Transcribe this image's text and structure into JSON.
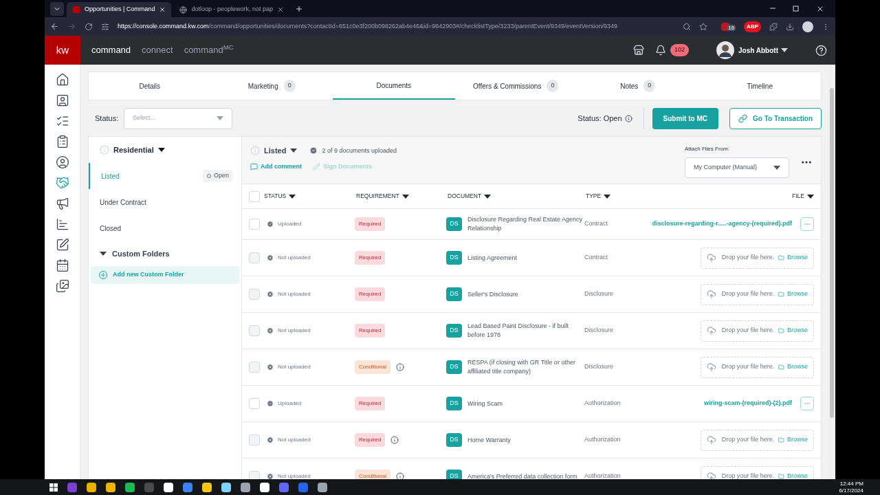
{
  "browser": {
    "tabs": [
      {
        "title": "Opportunities | Command",
        "selected": true
      },
      {
        "title": "dotloop - peoplework, not pap",
        "selected": false
      }
    ],
    "url_host": "https://console.command.kw.com",
    "url_path": "/command/opportunities/documents?contactId=651c0e3f200b098262ab4e46&id=9642903#/checklistType/3233/parentEvent/9349/eventVersion/9349",
    "extension_badge": "16",
    "adblock_label": "ABP"
  },
  "header": {
    "logo": "kw",
    "nav": [
      {
        "label": "command",
        "selected": true
      },
      {
        "label": "connect",
        "selected": false
      },
      {
        "label": "command$^{MC}$",
        "selected": false
      }
    ],
    "notification_count": "102",
    "user": "Josh Abbott"
  },
  "sidebar": [
    {
      "selected": false
    },
    {
      "selected": false
    },
    {
      "selected": false
    },
    {
      "selected": false
    },
    {
      "selected": false
    },
    {
      "selected": true
    },
    {
      "selected": false
    },
    {
      "selected": false
    },
    {
      "selected": false
    },
    {
      "selected": false
    },
    {
      "selected": false
    }
  ],
  "page_tabs": [
    {
      "label": "Details",
      "selected": false
    },
    {
      "label": "Marketing",
      "count": "0",
      "selected": false
    },
    {
      "label": "Documents",
      "selected": true
    },
    {
      "label": "Offers & Commissions",
      "count": "0",
      "selected": false
    },
    {
      "label": "Notes",
      "count": "0",
      "selected": false
    },
    {
      "label": "Timeline",
      "selected": false
    }
  ],
  "toolbar": {
    "status_label": "Status:",
    "status_placeholder": "Select...",
    "status_text": "Status: Open",
    "submit": "Submit to MC",
    "go": "Go To Transaction"
  },
  "stages": {
    "group": "Residential",
    "items": [
      {
        "label": "Listed",
        "badge": "Open",
        "selected": true
      },
      {
        "label": "Under Contract",
        "selected": false
      },
      {
        "label": "Closed",
        "selected": false
      }
    ],
    "custom_folders": "Custom Folders",
    "add_folder": "Add new Custom Folder"
  },
  "documents": {
    "stage": "Listed",
    "progress": "2 of 9 documents uploaded",
    "add_comment": "Add comment",
    "sign": {
      "label": "Sign Documents",
      "disabled": true
    },
    "attach_label": "Attach Files From:",
    "attach_value": "My Computer (Manual)",
    "select_all_checked": false,
    "columns": [
      "STATUS",
      "REQUIREMENT",
      "DOCUMENT",
      "TYPE",
      "FILE"
    ],
    "rows": [
      {
        "uploaded": true,
        "status": "Uploaded",
        "requirement": {
          "text": "Required",
          "kind": "required"
        },
        "info": false,
        "badge": "DS",
        "name": "Disclosure Regarding Real Estate Agency Relationship",
        "type": "Contract",
        "file": {
          "kind": "file",
          "name": "disclosure-regarding-r.....-agency-(required).pdf"
        }
      },
      {
        "uploaded": false,
        "status": "Not uploaded",
        "requirement": {
          "text": "Required",
          "kind": "required"
        },
        "info": false,
        "badge": "DS",
        "name": "Listing Agreement",
        "type": "Contract",
        "file": {
          "kind": "drop",
          "text": "Drop your file here.",
          "browse": "Browse"
        }
      },
      {
        "uploaded": false,
        "status": "Not uploaded",
        "requirement": {
          "text": "Required",
          "kind": "required"
        },
        "info": false,
        "badge": "DS",
        "name": "Seller's Disclosure",
        "type": "Disclosure",
        "file": {
          "kind": "drop",
          "text": "Drop your file here.",
          "browse": "Browse"
        }
      },
      {
        "uploaded": false,
        "status": "Not uploaded",
        "requirement": {
          "text": "Required",
          "kind": "required"
        },
        "info": false,
        "badge": "DS",
        "name": "Lead Based Paint Disclosure - if built before 1978",
        "type": "Disclosure",
        "file": {
          "kind": "drop",
          "text": "Drop your file here.",
          "browse": "Browse"
        }
      },
      {
        "uploaded": false,
        "status": "Not uploaded",
        "requirement": {
          "text": "Conditional",
          "kind": "conditional"
        },
        "info": true,
        "badge": "DS",
        "name": "RESPA (if closing with GR Title or other affiliated title company)",
        "type": "Disclosure",
        "file": {
          "kind": "drop",
          "text": "Drop your file here.",
          "browse": "Browse"
        }
      },
      {
        "uploaded": true,
        "status": "Uploaded",
        "requirement": {
          "text": "Required",
          "kind": "required"
        },
        "info": false,
        "badge": "DS",
        "name": "Wiring Scam",
        "type": "Authorization",
        "file": {
          "kind": "file",
          "name": "wiring-scam-(required)-(2).pdf"
        }
      },
      {
        "uploaded": false,
        "status": "Not uploaded",
        "requirement": {
          "text": "Required",
          "kind": "required"
        },
        "info": true,
        "badge": "DS",
        "name": "Home Warranty",
        "type": "Authorization",
        "file": {
          "kind": "drop",
          "text": "Drop your file here.",
          "browse": "Browse"
        }
      },
      {
        "uploaded": false,
        "status": "Not uploaded",
        "requirement": {
          "text": "Conditional",
          "kind": "conditional"
        },
        "info": true,
        "badge": "DS",
        "name": "America's Preferred data collection form",
        "type": "Authorization",
        "file": {
          "kind": "drop",
          "text": "Drop your file here.",
          "browse": "Browse"
        }
      }
    ]
  },
  "taskbar": {
    "time": "12:44 PM",
    "date": "6/17/2024"
  }
}
